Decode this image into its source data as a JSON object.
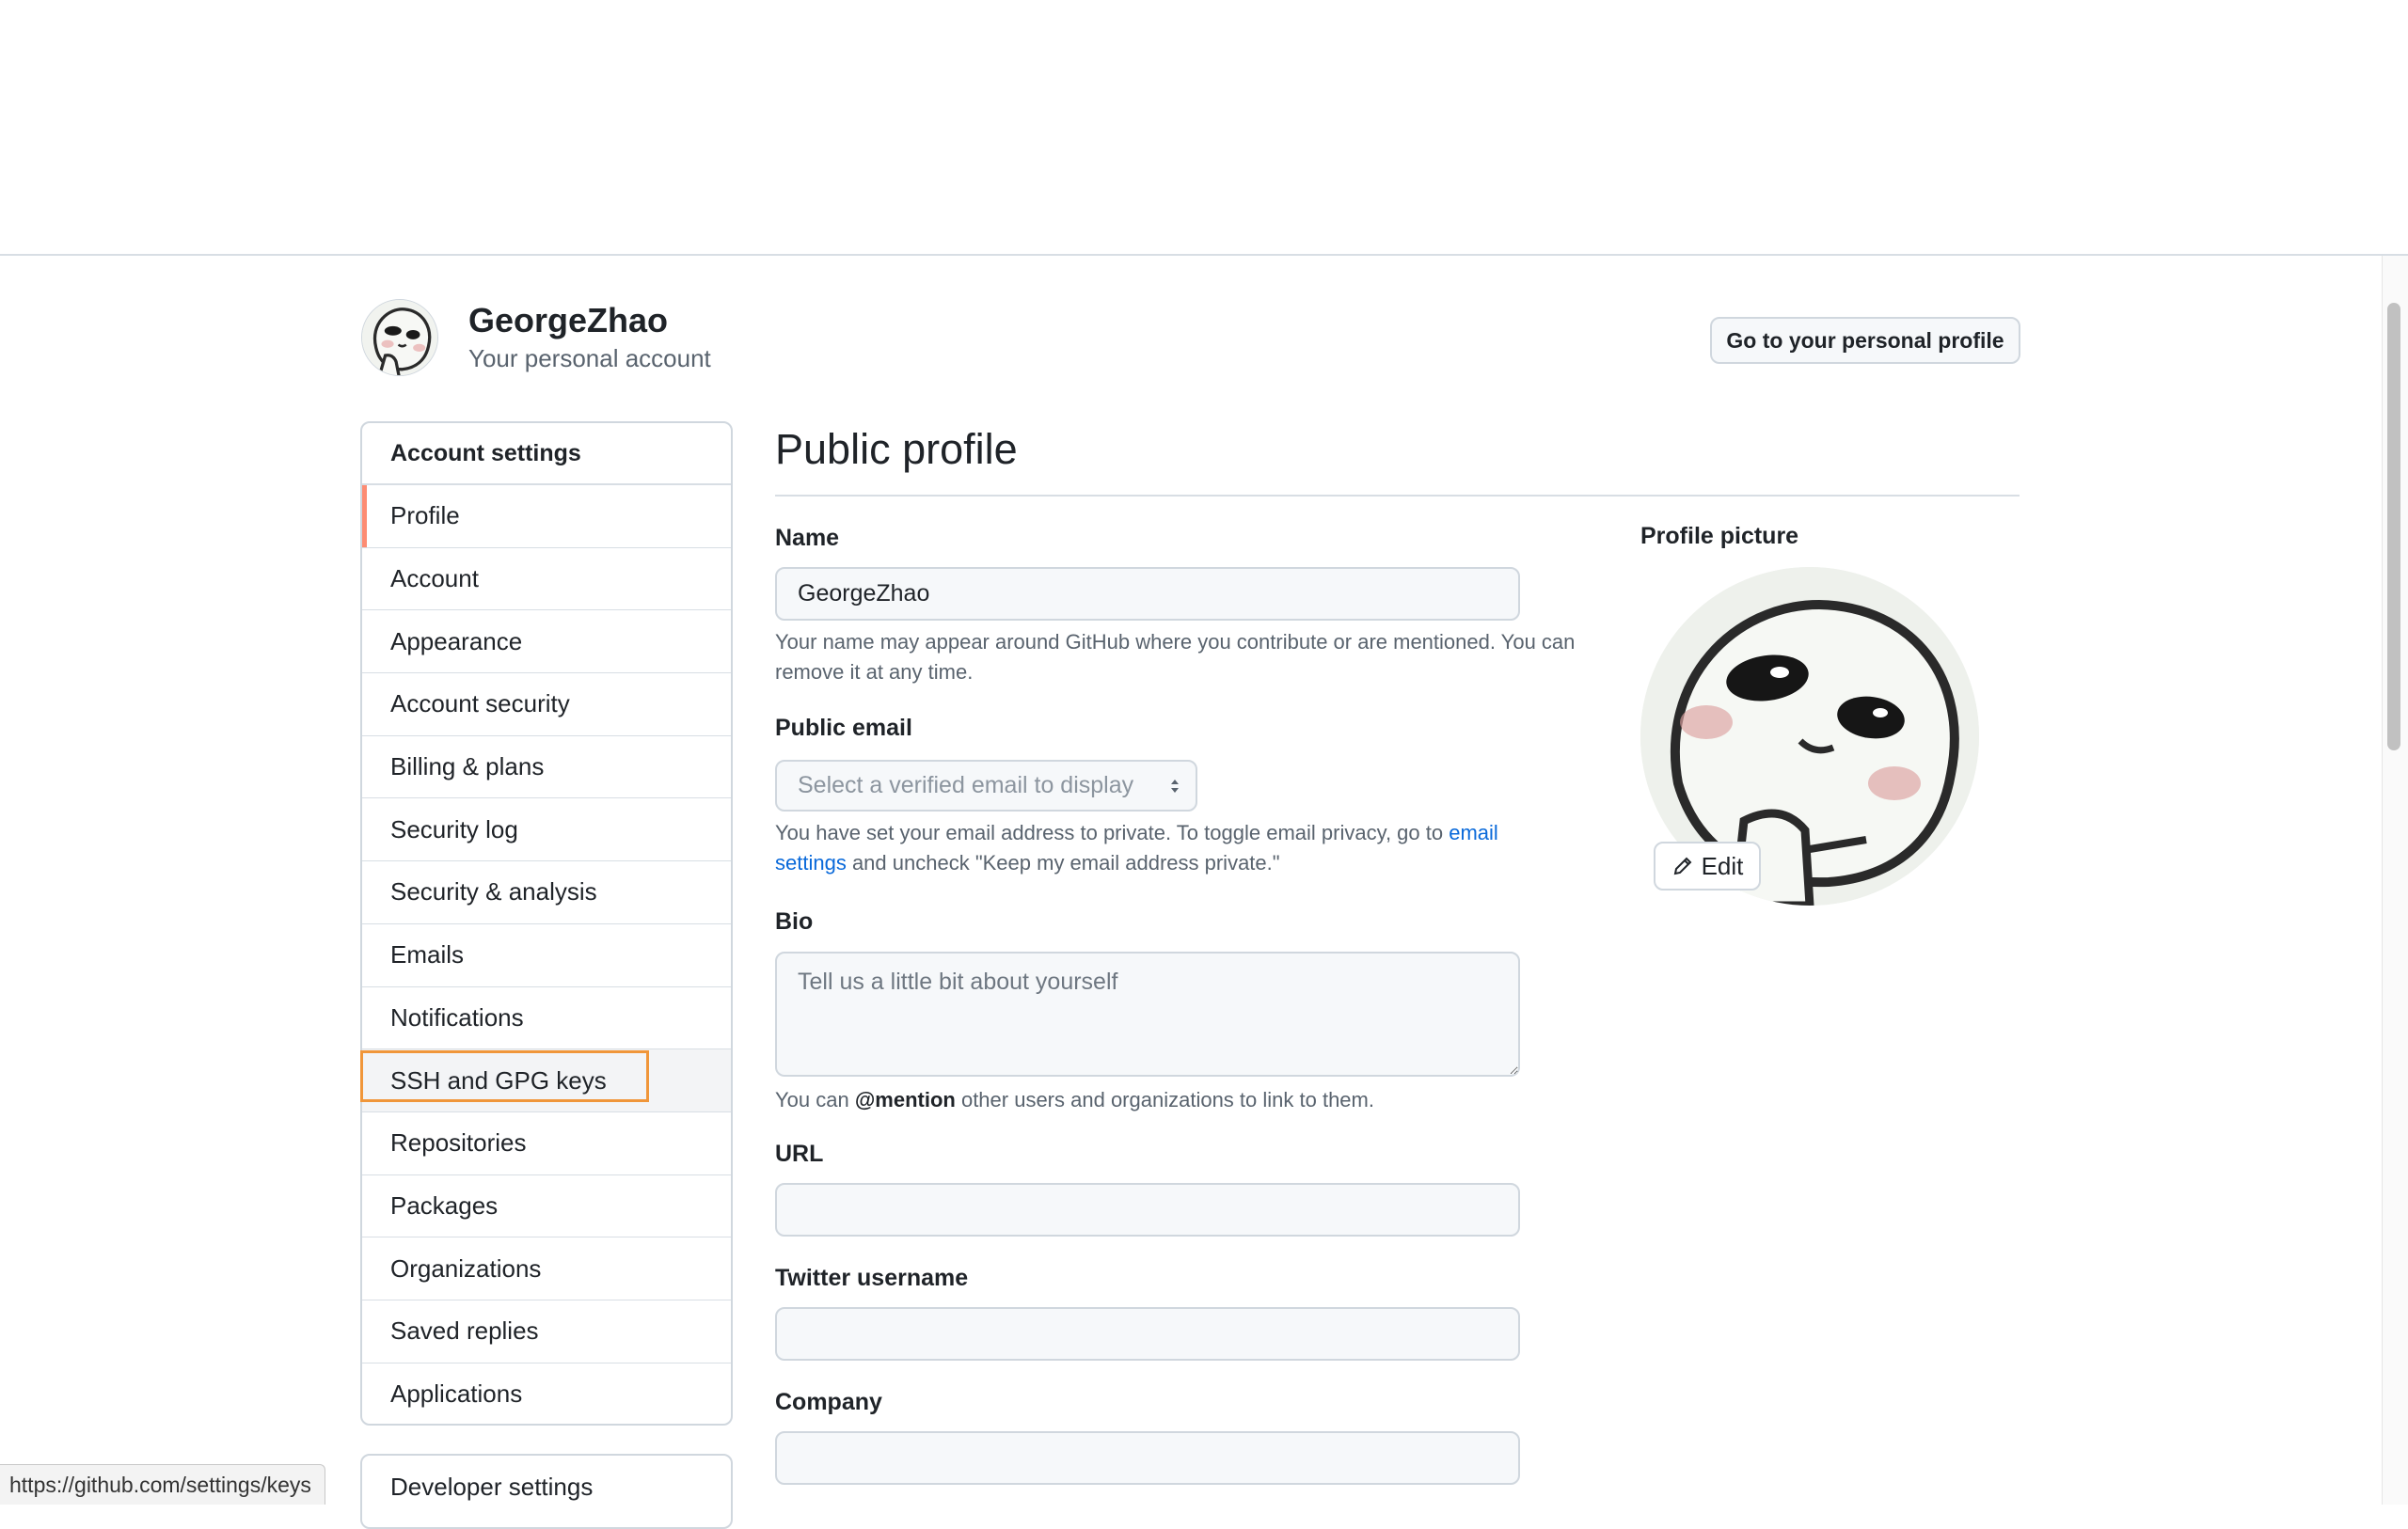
{
  "header": {
    "username": "GeorgeZhao",
    "subtitle": "Your personal account",
    "profile_button": "Go to your personal profile"
  },
  "sidebar": {
    "heading": "Account settings",
    "items": [
      {
        "label": "Profile",
        "active": true
      },
      {
        "label": "Account"
      },
      {
        "label": "Appearance"
      },
      {
        "label": "Account security"
      },
      {
        "label": "Billing & plans"
      },
      {
        "label": "Security log"
      },
      {
        "label": "Security & analysis"
      },
      {
        "label": "Emails"
      },
      {
        "label": "Notifications"
      },
      {
        "label": "SSH and GPG keys",
        "hovered": true
      },
      {
        "label": "Repositories"
      },
      {
        "label": "Packages"
      },
      {
        "label": "Organizations"
      },
      {
        "label": "Saved replies"
      },
      {
        "label": "Applications"
      }
    ],
    "developer_settings": "Developer settings"
  },
  "main": {
    "title": "Public profile",
    "name": {
      "label": "Name",
      "value": "GeorgeZhao",
      "note": "Your name may appear around GitHub where you contribute or are mentioned. You can remove it at any time."
    },
    "public_email": {
      "label": "Public email",
      "placeholder": "Select a verified email to display",
      "note_before": "You have set your email address to private. To toggle email privacy, go to ",
      "note_link": "email settings",
      "note_after": " and uncheck \"Keep my email address private.\""
    },
    "bio": {
      "label": "Bio",
      "placeholder": "Tell us a little bit about yourself",
      "note_before": "You can ",
      "note_bold": "@mention",
      "note_after": " other users and organizations to link to them."
    },
    "url": {
      "label": "URL",
      "value": ""
    },
    "twitter": {
      "label": "Twitter username",
      "value": ""
    },
    "company": {
      "label": "Company",
      "value": ""
    }
  },
  "profile_picture": {
    "label": "Profile picture",
    "edit_label": "Edit"
  },
  "statusbar": {
    "url": "https://github.com/settings/keys"
  },
  "colors": {
    "accent_active": "#fd8c73",
    "link": "#0969da",
    "highlight": "#f0963a"
  }
}
